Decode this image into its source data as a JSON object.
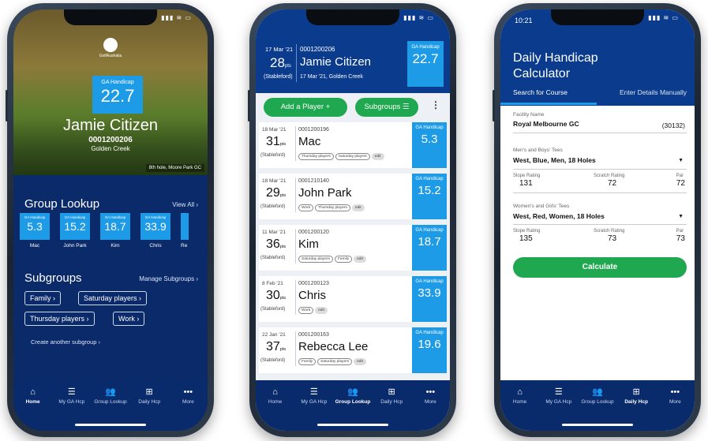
{
  "phone1": {
    "status": {
      "time": "",
      "icons": "▮▮▮ ≋ ▭"
    },
    "logo_text": "GolfAustralia",
    "hero": {
      "handicap_label": "GA Handicap",
      "handicap_value": "22.7",
      "name": "Jamie Citizen",
      "member_id": "0001200206",
      "club": "Golden Creek",
      "caption": "8th hole, Moore Park GC"
    },
    "group_lookup": {
      "title": "Group Lookup",
      "view_all": "View All  ›",
      "items": [
        {
          "label": "GA Handicap",
          "value": "5.3",
          "name": "Mac"
        },
        {
          "label": "GA Handicap",
          "value": "15.2",
          "name": "John Park"
        },
        {
          "label": "GA Handicap",
          "value": "18.7",
          "name": "Kim"
        },
        {
          "label": "GA Handicap",
          "value": "33.9",
          "name": "Chris"
        },
        {
          "label": "",
          "value": "",
          "name": "Re"
        }
      ]
    },
    "subgroups": {
      "title": "Subgroups",
      "manage": "Manage Subgroups  ›",
      "chips": [
        "Family  ›",
        "Saturday players  ›",
        "Thursday players  ›",
        "Work  ›"
      ],
      "create": "Create another subgroup  ›"
    }
  },
  "tabs": [
    "Home",
    "My GA Hcp",
    "Group Lookup",
    "Daily Hcp",
    "More"
  ],
  "tab_icons": [
    "⌂",
    "☰",
    "👥",
    "⊞",
    "•••"
  ],
  "phone2": {
    "header": {
      "date": "17 Mar '21",
      "points": "28",
      "pts_unit": "pts",
      "mode": "(Stableford)",
      "member_id": "0001200206",
      "name": "Jamie Citizen",
      "sub": "17 Mar '21, Golden Creek",
      "hcp_label": "GA Handicap",
      "hcp_value": "22.7"
    },
    "add_player": "Add a Player  +",
    "subgroups": "Subgroups  ☰",
    "kebab": "⋮",
    "players": [
      {
        "date": "18 Mar '21",
        "points": "31",
        "mode": "(Stableford)",
        "id": "0001200196",
        "name": "Mac",
        "tags": [
          "Thursday players",
          "Saturday players",
          "edit"
        ],
        "hcp_label": "GA Handicap",
        "hcp": "5.3"
      },
      {
        "date": "18 Mar '21",
        "points": "29",
        "mode": "(Stableford)",
        "id": "0001210140",
        "name": "John Park",
        "tags": [
          "Work",
          "Thursday players",
          "edit"
        ],
        "hcp_label": "GA Handicap",
        "hcp": "15.2"
      },
      {
        "date": "11 Mar '21",
        "points": "36",
        "mode": "(Stableford)",
        "id": "0001200120",
        "name": "Kim",
        "tags": [
          "Saturday players",
          "Family",
          "edit"
        ],
        "hcp_label": "GA Handicap",
        "hcp": "18.7"
      },
      {
        "date": "8 Feb '21",
        "points": "30",
        "mode": "(Stableford)",
        "id": "0001200123",
        "name": "Chris",
        "tags": [
          "Work",
          "edit"
        ],
        "hcp_label": "GA Handicap",
        "hcp": "33.9"
      },
      {
        "date": "22 Jan '21",
        "points": "37",
        "mode": "(Stableford)",
        "id": "0001200163",
        "name": "Rebecca Lee",
        "tags": [
          "Family",
          "Saturday players",
          "edit"
        ],
        "hcp_label": "GA Handicap",
        "hcp": "19.6"
      }
    ]
  },
  "phone3": {
    "time": "10:21",
    "title": "Daily Handicap Calculator",
    "tab_search": "Search for Course",
    "tab_manual": "Enter Details Manually",
    "facility_label": "Facility Name",
    "facility_value": "Royal Melbourne GC",
    "facility_code": "(30132)",
    "mens_label": "Men's and Boys' Tees",
    "mens_value": "West, Blue, Men, 18 Holes",
    "mens_ratings": {
      "slope_label": "Slope Rating",
      "slope": "131",
      "scratch_label": "Scratch Rating",
      "scratch": "72",
      "par_label": "Par",
      "par": "72"
    },
    "womens_label": "Women's and Girls' Tees",
    "womens_value": "West, Red, Women, 18 Holes",
    "womens_ratings": {
      "slope_label": "Slope Rating",
      "slope": "135",
      "scratch_label": "Scratch Rating",
      "scratch": "73",
      "par_label": "Par",
      "par": "73"
    },
    "calculate": "Calculate"
  },
  "colors": {
    "navy": "#0a3b8c",
    "blue": "#1e9be6",
    "green": "#1fa84f"
  }
}
